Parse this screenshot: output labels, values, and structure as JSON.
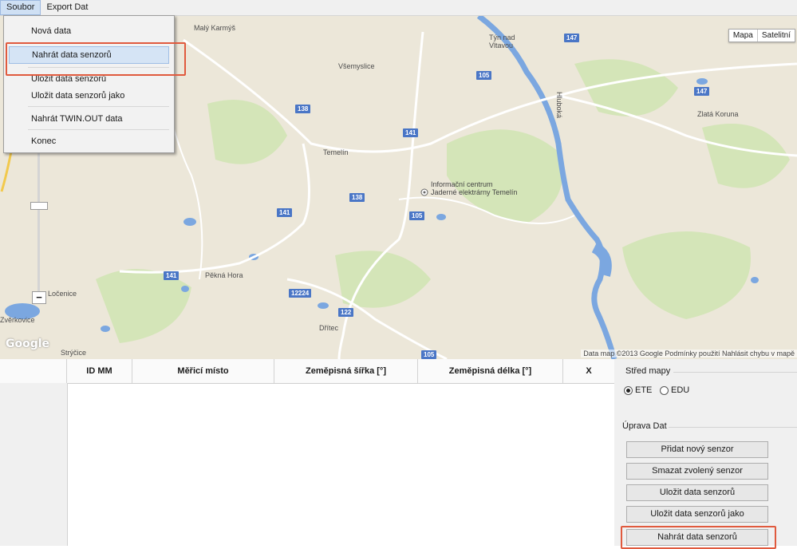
{
  "menubar": {
    "items": [
      "Soubor",
      "Export Dat"
    ]
  },
  "file_menu": {
    "items": [
      "Nová data",
      "Nahrát data senzorů",
      "Uložit data senzorů",
      "Uložit data senzorů jako",
      "Nahrát TWIN.OUT data",
      "Konec"
    ],
    "highlighted": "Nahrát data senzorů"
  },
  "map": {
    "type_buttons": [
      "Mapa",
      "Satelitní"
    ],
    "places": [
      "Malý Karmýš",
      "Týn nad Vltavou",
      "Všemyslice",
      "Temelín",
      "Informační centrum Jaderné elektrárny Temelín",
      "Pěkná Hora",
      "Dřítec",
      "Zlatá Koruna",
      "Ločenice"
    ],
    "roads": [
      "147",
      "105",
      "138",
      "141",
      "138",
      "141",
      "105",
      "141",
      "12224",
      "122",
      "105",
      "147"
    ],
    "logo": "Google",
    "attribution": "Data map ©2013 Google  Podmínky použití  Nahlásit chybu v mapě",
    "edge_labels": [
      "Hluboká",
      "Strýčice",
      "Zvěrkovice"
    ]
  },
  "table": {
    "columns": [
      "ID MM",
      "Měřicí místo",
      "Zeměpisná šířka [°]",
      "Zeměpisná délka [°]",
      "X"
    ]
  },
  "side_panel": {
    "map_center_title": "Střed mapy",
    "radio_options": [
      "ETE",
      "EDU"
    ],
    "radio_selected": "ETE",
    "edit_title": "Úprava Dat",
    "buttons": [
      "Přidat nový senzor",
      "Smazat zvolený senzor",
      "Uložit data senzorů",
      "Uložit data senzorů jako",
      "Nahrát data senzorů"
    ]
  },
  "colors": {
    "highlight": "#e05a3e",
    "road_badge": "#4a76c6",
    "water": "#7ba7e0",
    "forest": "#cfe3b4"
  }
}
